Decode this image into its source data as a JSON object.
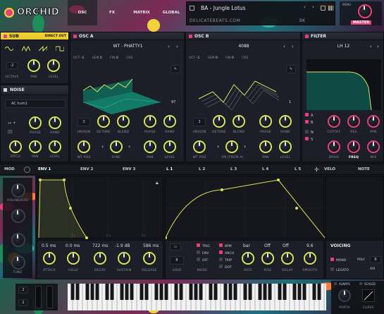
{
  "header": {
    "logo": "ORCHID",
    "tabs": [
      "OSC",
      "FX",
      "MATRIX",
      "GLOBAL"
    ],
    "preset_name": "BA - Jungle Lotus",
    "preset_sub": "DELICATEBEATS.COM",
    "bk": "BK",
    "master": "MASTER",
    "menu": "MENU"
  },
  "sub": {
    "title": "SUB",
    "direct_out": "DIRECT OUT",
    "octave_val": "-2",
    "labels": [
      "OCTAVE",
      "PAN",
      "LEVEL"
    ]
  },
  "noise": {
    "title": "NOISE",
    "preset": "AC hum1",
    "labels_top": [
      "PHASE",
      "RAND"
    ],
    "labels_bot": [
      "PITCH",
      "PAN",
      "LEVEL"
    ]
  },
  "osc_a": {
    "title": "OSC A",
    "wt": "WT - PHATTY1",
    "oct": "OCT",
    "oct_val": "-1",
    "sem": "SEM",
    "sem_val": "0",
    "fin": "FIN",
    "fin_val": "0",
    "crs": "CRS",
    "frame": "97",
    "unison_val": "3",
    "labels_top": [
      "UNISON",
      "DETUNE",
      "BLEND",
      "PHASE",
      "RAND"
    ],
    "labels_bot": [
      "WT POS",
      "SYNC",
      "PAN",
      "LEVEL"
    ]
  },
  "osc_b": {
    "title": "OSC B",
    "wt": "4088",
    "oct": "OCT",
    "oct_val": "-1",
    "sem": "SEM",
    "sem_val": "0",
    "fin": "FIN",
    "fin_val": "0",
    "crs": "CRS",
    "frame": "1",
    "unison_val": "3",
    "labels_top": [
      "UNISON",
      "DETUNE",
      "BLEND",
      "PHASE",
      "RAND"
    ],
    "labels_bot": [
      "WT POS",
      "FM (FROM A)",
      "PAN",
      "LEVEL"
    ]
  },
  "filter": {
    "title": "FILTER",
    "type": "LH 12",
    "route": [
      "A",
      "B",
      "N",
      "S"
    ],
    "labels_top": [
      "CUTOFF",
      "RES",
      "PAN"
    ],
    "labels_bot": [
      "DRIVE",
      "FREQ",
      "MIX"
    ]
  },
  "mod": {
    "tabs": [
      "MOD",
      "ENV 1",
      "ENV 2",
      "ENV 3",
      "L 1",
      "L 2",
      "L 3",
      "L 4",
      "L 5",
      "VELO",
      "NOTE"
    ],
    "side_label": "HOLINDOOG",
    "side_label2": "TUNE"
  },
  "env": {
    "values": [
      "0.5 ms",
      "0.0 ms",
      "722 ms",
      "-1.9 dB",
      "586 ms"
    ],
    "labels": [
      "ATTACK",
      "HOLD",
      "DECAY",
      "SUSTAIN",
      "RELEASE"
    ],
    "axis": [
      "1 s",
      "2 s",
      "3 s"
    ]
  },
  "lfo": {
    "grid_val": "8",
    "options": [
      "TRIG",
      "ENV",
      "OFF",
      "BPM",
      "ANCH",
      "TRIP",
      "DOT"
    ],
    "values": [
      "bar",
      "Off",
      "Off",
      "9.6"
    ],
    "labels": [
      "GRID",
      "MODE",
      "RATE",
      "RISE",
      "DELAY",
      "SMOOTH"
    ]
  },
  "voicing": {
    "title": "VOICING",
    "mono": "MONO",
    "poly": "POLY",
    "poly_val": "8",
    "legato": "LEGATO",
    "legato_val": "0/0",
    "always": "ALWAYS",
    "scaled": "SCALED",
    "porta": "PORTA",
    "curve": "CURVE"
  },
  "keyboard": {
    "pitch_up": "2",
    "pitch_down": "2"
  }
}
